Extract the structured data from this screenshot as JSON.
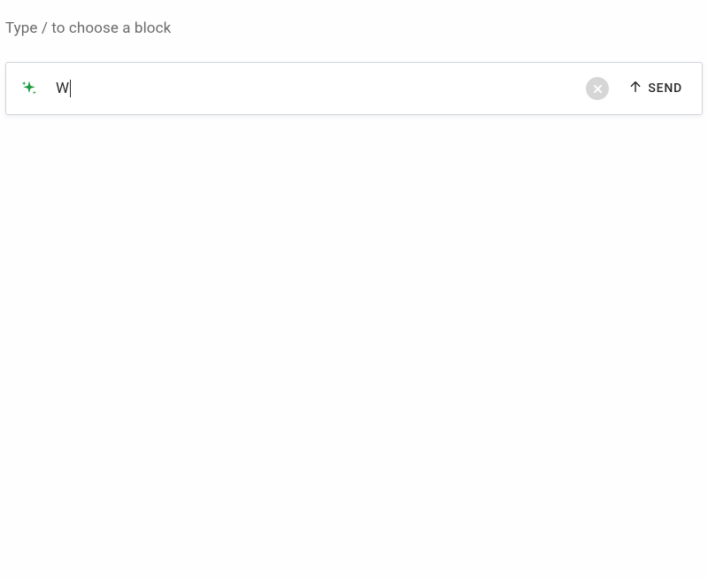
{
  "hint": "Type / to choose a block",
  "input": {
    "value": "W",
    "placeholder": ""
  },
  "send": {
    "label": "SEND"
  },
  "colors": {
    "sparkle": "#1a9a3f",
    "clear_bg": "#d6d6d6",
    "clear_x": "#ffffff",
    "arrow": "#2a2a2a"
  }
}
